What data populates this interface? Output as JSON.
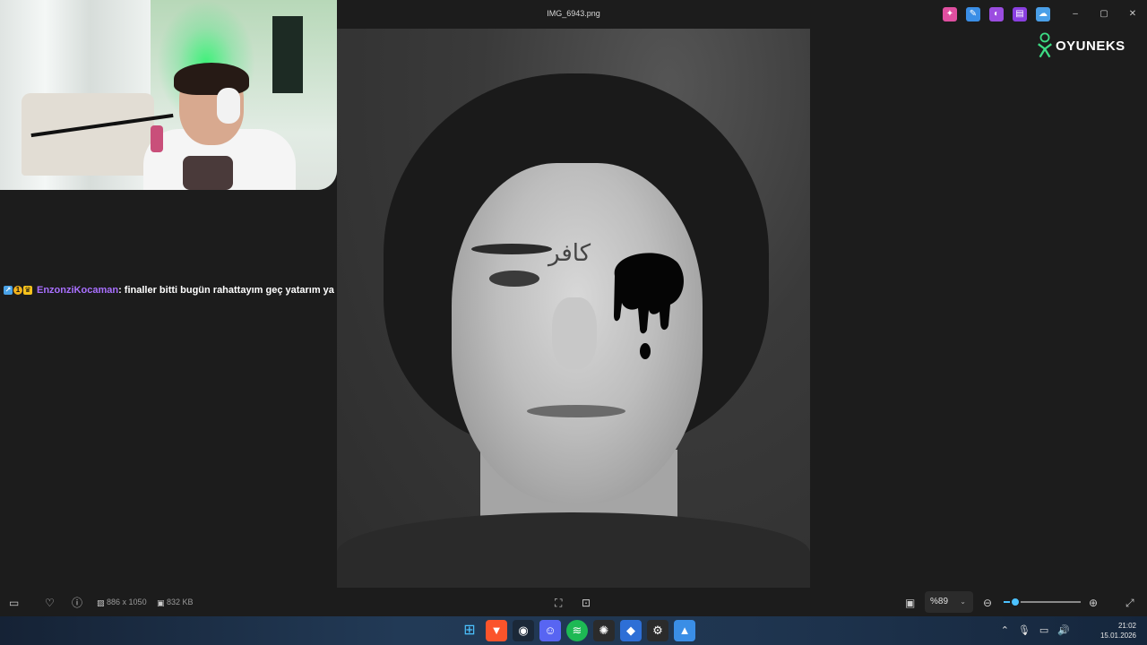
{
  "window": {
    "title": "IMG_6943.png",
    "controls": {
      "minimize": "–",
      "maximize": "▢",
      "close": "✕"
    },
    "toolbar_icons": [
      {
        "name": "copilot-icon",
        "color": "#e04fa0"
      },
      {
        "name": "edit-icon",
        "color": "#3a8ee6"
      },
      {
        "name": "clipchamp-icon",
        "color": "#9b4de0"
      },
      {
        "name": "video-editor-icon",
        "color": "#8a3fe0"
      },
      {
        "name": "onedrive-off-icon",
        "color": "#4a9fe8"
      }
    ]
  },
  "chat": {
    "badges": [
      "prime-badge",
      "gift-badge",
      "crown-badge"
    ],
    "username": "EnzonziKocaman",
    "message": ": finaller bitti bugün rahattayım geç yatarım ya",
    "username_color": "#a970ff"
  },
  "photo": {
    "overlay_text": "كافر",
    "style": "grayscale"
  },
  "logo": {
    "text": "OYUNEKS"
  },
  "bottombar": {
    "dimensions": "886 x 1050",
    "file_size": "832 KB",
    "zoom_label": "%89",
    "zoom_value": 0.15
  },
  "taskbar": {
    "icons": [
      "windows-start-icon",
      "brave-icon",
      "steam-icon",
      "discord-icon",
      "spotify-icon",
      "chatgpt-icon",
      "app-blue-icon",
      "steelseries-icon",
      "photos-icon"
    ],
    "time": "21:02",
    "date": "15.01.2026"
  },
  "colors": {
    "accent": "#4cc2ff",
    "background": "#1c1c1c"
  }
}
